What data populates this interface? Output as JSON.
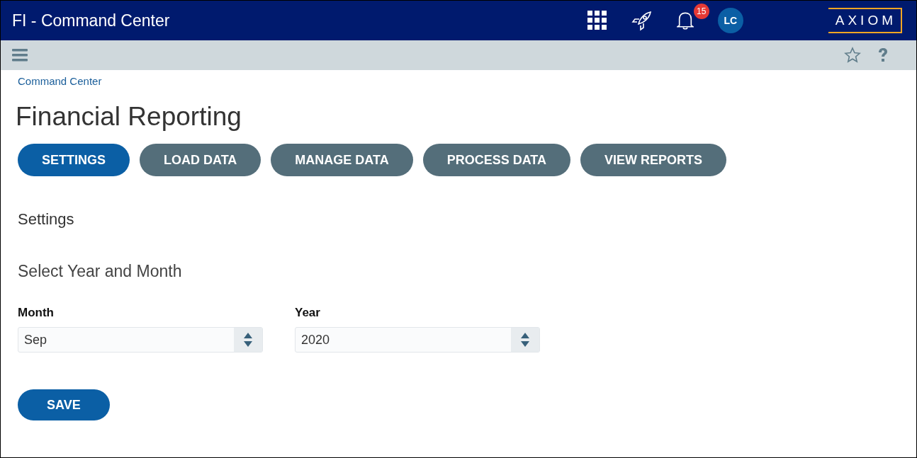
{
  "header": {
    "title": "FI - Command Center",
    "notifications": {
      "count": "15"
    },
    "avatar": {
      "initials": "LC"
    },
    "logo": "AXIOM"
  },
  "breadcrumb": "Command Center",
  "page_title": "Financial Reporting",
  "tabs": [
    {
      "label": "SETTINGS",
      "selected": true
    },
    {
      "label": "LOAD DATA",
      "selected": false
    },
    {
      "label": "MANAGE DATA",
      "selected": false
    },
    {
      "label": "PROCESS DATA",
      "selected": false
    },
    {
      "label": "VIEW REPORTS",
      "selected": false
    }
  ],
  "section_title": "Settings",
  "subsection_title": "Select Year and Month",
  "fields": [
    {
      "label": "Month",
      "value": "Sep"
    },
    {
      "label": "Year",
      "value": "2020"
    }
  ],
  "save_button": "SAVE"
}
